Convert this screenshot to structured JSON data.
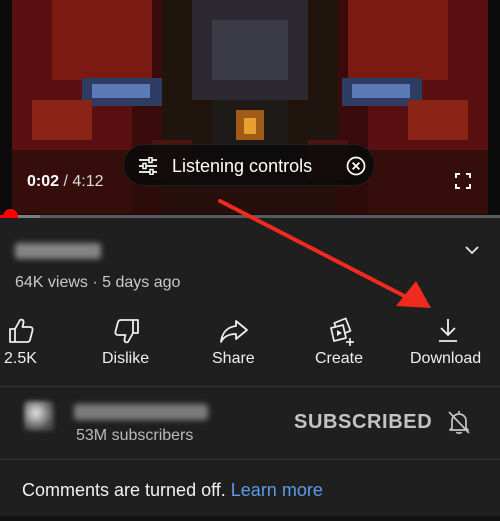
{
  "player": {
    "current_time": "0:02",
    "separator": " / ",
    "duration": "4:12",
    "progress_fraction": 0.008,
    "buffered_fraction": 0.08,
    "listening_controls_label": "Listening controls"
  },
  "video": {
    "meta": "64K views · 5 days ago"
  },
  "actions": {
    "like_count": "2.5K",
    "dislike": "Dislike",
    "share": "Share",
    "create": "Create",
    "download": "Download"
  },
  "channel": {
    "subscribers": "53M subscribers",
    "subscribed_label": "SUBSCRIBED"
  },
  "comments": {
    "text": "Comments are turned off.",
    "link": "Learn more"
  },
  "colors": {
    "accent_red": "#ff0000",
    "link_blue": "#5a9bea",
    "annotation_arrow": "#ef2b1f"
  },
  "icons": {
    "tune": "tune-icon",
    "close": "close-circle-icon",
    "fullscreen": "fullscreen-icon",
    "chevron": "chevron-down-icon",
    "like": "thumbs-up-icon",
    "dislike": "thumbs-down-icon",
    "share": "share-arrow-icon",
    "create": "create-sparkle-icon",
    "download": "download-icon",
    "bell": "bell-off-icon"
  }
}
